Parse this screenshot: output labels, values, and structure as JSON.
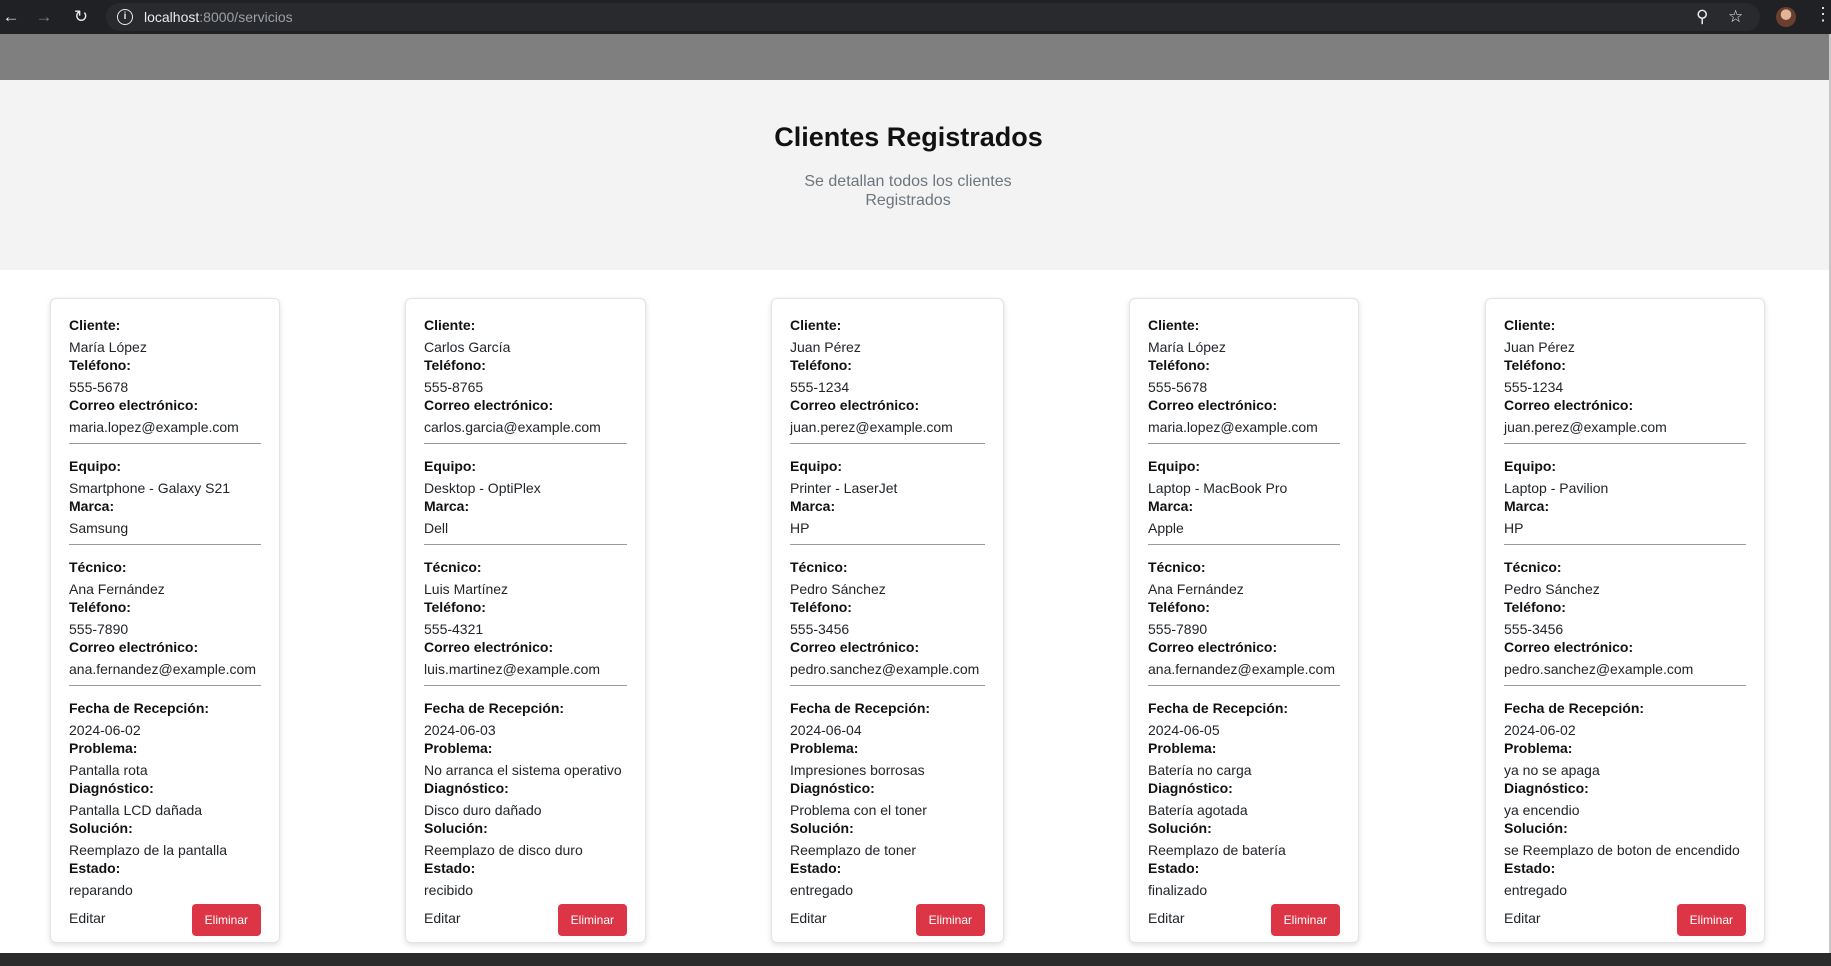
{
  "browser": {
    "url_host": "localhost",
    "url_path": ":8000/servicios"
  },
  "hero": {
    "title": "Clientes Registrados",
    "subtitle_line1": "Se detallan todos los clientes",
    "subtitle_line2": "Registrados"
  },
  "labels": {
    "cliente": "Cliente:",
    "telefono": "Teléfono:",
    "correo": "Correo electrónico:",
    "equipo": "Equipo:",
    "marca": "Marca:",
    "tecnico": "Técnico:",
    "fecha": "Fecha de Recepción:",
    "problema": "Problema:",
    "diagnostico": "Diagnóstico:",
    "solucion": "Solución:",
    "estado": "Estado:",
    "editar": "Editar",
    "eliminar": "Eliminar"
  },
  "cards": [
    {
      "cliente": "María López",
      "telefono": "555-5678",
      "correo": "maria.lopez@example.com",
      "equipo": "Smartphone - Galaxy S21",
      "marca": "Samsung",
      "tecnico": "Ana Fernández",
      "tec_telefono": "555-7890",
      "tec_correo": "ana.fernandez@example.com",
      "fecha": "2024-06-02",
      "problema": "Pantalla rota",
      "diagnostico": "Pantalla LCD dañada",
      "solucion": "Reemplazo de la pantalla",
      "estado": "reparando"
    },
    {
      "cliente": "Carlos García",
      "telefono": "555-8765",
      "correo": "carlos.garcia@example.com",
      "equipo": "Desktop - OptiPlex",
      "marca": "Dell",
      "tecnico": "Luis Martínez",
      "tec_telefono": "555-4321",
      "tec_correo": "luis.martinez@example.com",
      "fecha": "2024-06-03",
      "problema": "No arranca el sistema operativo",
      "diagnostico": "Disco duro dañado",
      "solucion": "Reemplazo de disco duro",
      "estado": "recibido"
    },
    {
      "cliente": "Juan Pérez",
      "telefono": "555-1234",
      "correo": "juan.perez@example.com",
      "equipo": "Printer - LaserJet",
      "marca": "HP",
      "tecnico": "Pedro Sánchez",
      "tec_telefono": "555-3456",
      "tec_correo": "pedro.sanchez@example.com",
      "fecha": "2024-06-04",
      "problema": "Impresiones borrosas",
      "diagnostico": "Problema con el toner",
      "solucion": "Reemplazo de toner",
      "estado": "entregado"
    },
    {
      "cliente": "María López",
      "telefono": "555-5678",
      "correo": "maria.lopez@example.com",
      "equipo": "Laptop - MacBook Pro",
      "marca": "Apple",
      "tecnico": "Ana Fernández",
      "tec_telefono": "555-7890",
      "tec_correo": "ana.fernandez@example.com",
      "fecha": "2024-06-05",
      "problema": "Batería no carga",
      "diagnostico": "Batería agotada",
      "solucion": "Reemplazo de batería",
      "estado": "finalizado"
    },
    {
      "cliente": "Juan Pérez",
      "telefono": "555-1234",
      "correo": "juan.perez@example.com",
      "equipo": "Laptop - Pavilion",
      "marca": "HP",
      "tecnico": "Pedro Sánchez",
      "tec_telefono": "555-3456",
      "tec_correo": "pedro.sanchez@example.com",
      "fecha": "2024-06-02",
      "problema": "ya no se apaga",
      "diagnostico": "ya encendio",
      "solucion": "se Reemplazo de boton de encendido",
      "estado": "entregado"
    }
  ]
}
